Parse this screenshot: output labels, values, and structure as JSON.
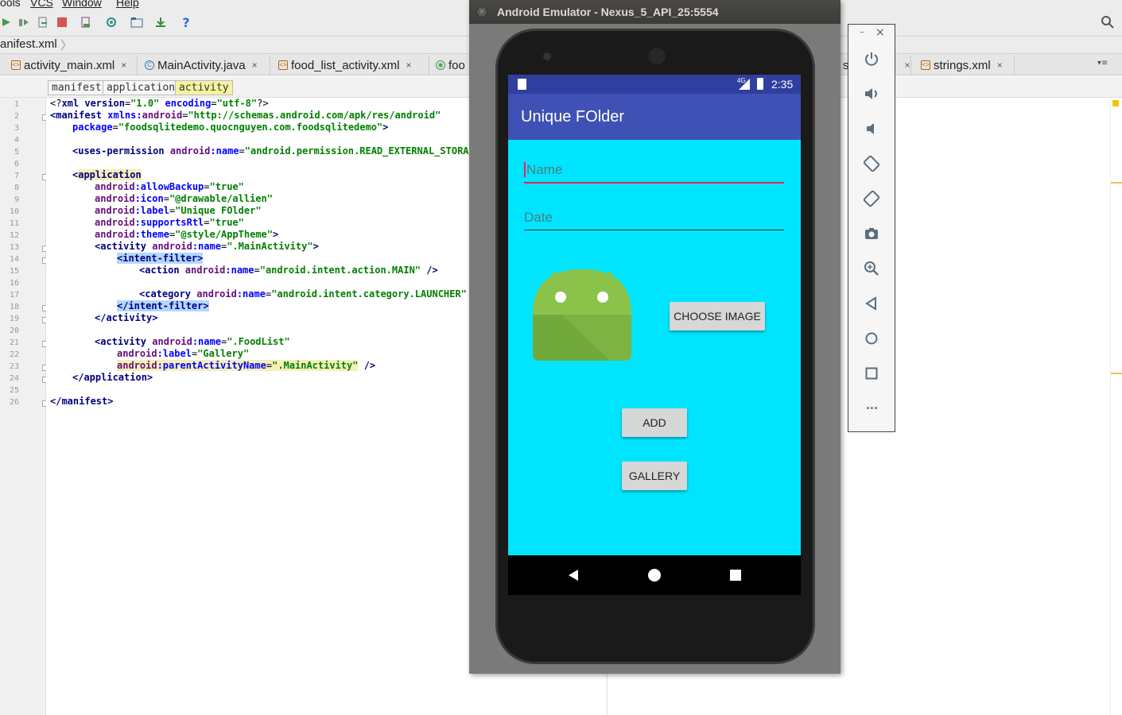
{
  "ide": {
    "menu": [
      "ools",
      "VCS",
      "Window",
      "Help"
    ],
    "nav_file": "anifest.xml",
    "tabs": [
      {
        "label": "activity_main.xml",
        "icon": "xml-file-icon"
      },
      {
        "label": "MainActivity.java",
        "icon": "java-class-icon"
      },
      {
        "label": "food_list_activity.xml",
        "icon": "xml-file-icon"
      },
      {
        "label": "foo",
        "icon": "android-file-icon"
      },
      {
        "label": "s",
        "icon": "xml-file-icon"
      },
      {
        "label": "strings.xml",
        "icon": "xml-file-icon"
      }
    ],
    "tab_close": "×",
    "breadcrumbs": [
      "manifest",
      "application",
      "activity"
    ],
    "line_numbers": [
      "1",
      "2",
      "3",
      "4",
      "5",
      "6",
      "7",
      "8",
      "9",
      "10",
      "11",
      "12",
      "13",
      "14",
      "15",
      "16",
      "17",
      "18",
      "19",
      "20",
      "21",
      "22",
      "23",
      "24",
      "25",
      "26"
    ],
    "code": {
      "l1a": "<?",
      "l1b": "xml version",
      "l1c": "=",
      "l1d": "\"1.0\"",
      "l1e": " encoding",
      "l1f": "=",
      "l1g": "\"utf-8\"",
      "l1h": "?>",
      "l2a": "<manifest ",
      "l2b": "xmlns:",
      "l2c": "android",
      "l2d": "=",
      "l2e": "\"http://schemas.android.com/apk/res/android\"",
      "l3a": "package",
      "l3b": "=",
      "l3c": "\"foodsqlitedemo.quocnguyen.com.foodsqlitedemo\"",
      "l3d": ">",
      "l5a": "<uses-permission ",
      "l5b": "android",
      "l5c": ":name",
      "l5d": "=",
      "l5e": "\"android.permission.READ_EXTERNAL_STORAGE\"",
      "l7a": "<",
      "l7b": "application",
      "l8a": "android",
      "l8b": ":allowBackup",
      "l8c": "=",
      "l8d": "\"true\"",
      "l9a": "android",
      "l9b": ":icon",
      "l9c": "=",
      "l9d": "\"@drawable/allien\"",
      "l10a": "android",
      "l10b": ":label",
      "l10c": "=",
      "l10d": "\"Unique FOlder\"",
      "l11a": "android",
      "l11b": ":supportsRtl",
      "l11c": "=",
      "l11d": "\"true\"",
      "l12a": "android",
      "l12b": ":theme",
      "l12c": "=",
      "l12d": "\"@style/AppTheme\"",
      "l12e": ">",
      "l13a": "<activity ",
      "l13b": "android",
      "l13c": ":name",
      "l13d": "=",
      "l13e": "\".MainActivity\"",
      "l13f": ">",
      "l14a": "<intent-filter>",
      "l15a": "<action ",
      "l15b": "android",
      "l15c": ":name",
      "l15d": "=",
      "l15e": "\"android.intent.action.MAIN\"",
      "l15f": " />",
      "l17a": "<category ",
      "l17b": "android",
      "l17c": ":name",
      "l17d": "=",
      "l17e": "\"android.intent.category.LAUNCHER\"",
      "l17f": " />",
      "l18a": "</intent-filter>",
      "l19a": "</activity>",
      "l21a": "<activity ",
      "l21b": "android",
      "l21c": ":name",
      "l21d": "=",
      "l21e": "\".FoodList\"",
      "l22a": "android",
      "l22b": ":label",
      "l22c": "=",
      "l22d": "\"Gallery\"",
      "l23a": "android",
      "l23b": ":parentActivityName",
      "l23c": "=",
      "l23d": "\".MainActivity\"",
      "l23e": " />",
      "l24a": "</application>",
      "l26a": "</manifest>"
    }
  },
  "emulator": {
    "title": "Android Emulator - Nexus_5_API_25:5554",
    "status": {
      "network": "4G",
      "time": "2:35"
    },
    "app_title": "Unique FOlder",
    "name_placeholder": "Name",
    "date_placeholder": "Date",
    "choose_image": "CHOOSE IMAGE",
    "add": "ADD",
    "gallery": "GALLERY",
    "controls": [
      "power-icon",
      "volume-up-icon",
      "volume-down-icon",
      "rotate-left-icon",
      "rotate-right-icon",
      "camera-icon",
      "zoom-icon",
      "back-icon",
      "home-icon",
      "overview-icon",
      "more-icon"
    ],
    "window_buttons": {
      "minimize": "–",
      "close": "×"
    },
    "more_label": "•••"
  },
  "colors": {
    "app_bg": "#00e5ff",
    "app_bar": "#3f51b5",
    "status_bar": "#303f9f",
    "accent": "#e91e63"
  }
}
